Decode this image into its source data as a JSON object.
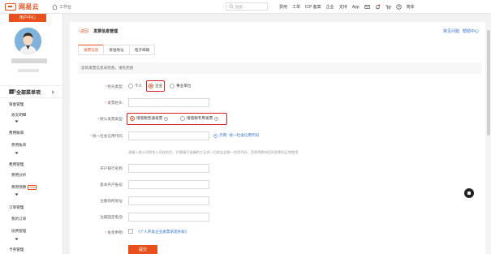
{
  "brand": {
    "name": "网易云",
    "color": "#e8501d"
  },
  "topbar": {
    "workbench": "工作台",
    "search_placeholder": "搜索...",
    "nav": [
      "费用",
      "工单",
      "ICP 备案",
      "企业",
      "支持",
      "App"
    ],
    "user": "简体"
  },
  "sidebar": {
    "user_center": "用户中心",
    "all_menu": "全部菜单项",
    "items": [
      {
        "label": "首页",
        "type": "head"
      },
      {
        "label": "资金管理",
        "type": "head"
      },
      {
        "label": "收支明细",
        "type": "item"
      },
      {
        "label": "费用账单",
        "type": "head"
      },
      {
        "label": "费用账单",
        "type": "item"
      },
      {
        "label": "费用管理",
        "type": "head"
      },
      {
        "label": "费用分析",
        "type": "item"
      },
      {
        "label": "费用预算",
        "type": "item",
        "badge": "New"
      },
      {
        "label": "订单管理",
        "type": "head"
      },
      {
        "label": "我的订单",
        "type": "item"
      },
      {
        "label": "续费管理",
        "type": "item"
      },
      {
        "label": "卡券管理",
        "type": "head"
      }
    ]
  },
  "page": {
    "back": "‹ 返回",
    "title": "发票信息管理",
    "help_links": [
      "常见问题",
      "帮助中心"
    ],
    "tabs": [
      "发票信息",
      "寄送地址",
      "电子邮箱"
    ],
    "active_tab": 0,
    "notice": "您的发票信息未完善，请先完善",
    "form": {
      "title_type_label": "抬头类型:",
      "title_type_options": [
        "个人",
        "企业",
        "事业单位"
      ],
      "title_type_selected": 1,
      "invoice_title_label": "发票抬头:",
      "invoice_type_label": "默认发票类型:",
      "invoice_type_options": [
        "增值税普通发票",
        "增值税专用发票"
      ],
      "invoice_type_selected": 0,
      "credit_code_label": "统一社会信用代码:",
      "example_label": "示例:",
      "credit_code_example": "统一社会信用代码",
      "hint": "请输入贵公司财务人员核实后，仔细填写准确的三证合一后的社会统一信用代码，否则将影响后续发票的正常使用",
      "bank_label": "开户银行名称:",
      "account_label": "基本开户账号:",
      "address_label": "注册场所地址:",
      "phone_label": "注册固定电话:",
      "free_review_label": "免责申明:",
      "agreement_link": "《个人开具企业发票承诺条款》",
      "submit": "提交"
    }
  }
}
